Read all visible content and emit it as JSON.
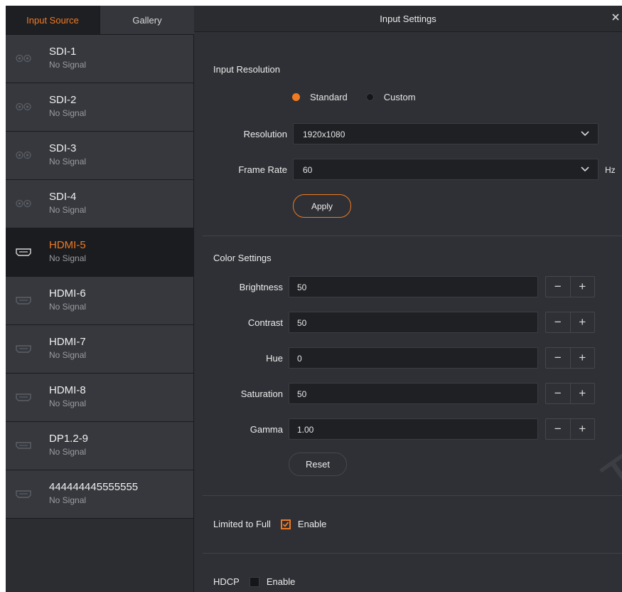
{
  "tabs": [
    {
      "label": "Input Source",
      "active": true
    },
    {
      "label": "Gallery",
      "active": false
    }
  ],
  "sources": [
    {
      "name": "SDI-1",
      "status": "No Signal",
      "icon": "sdi-connector-icon"
    },
    {
      "name": "SDI-2",
      "status": "No Signal",
      "icon": "sdi-connector-icon"
    },
    {
      "name": "SDI-3",
      "status": "No Signal",
      "icon": "sdi-connector-icon"
    },
    {
      "name": "SDI-4",
      "status": "No Signal",
      "icon": "sdi-connector-icon"
    },
    {
      "name": "HDMI-5",
      "status": "No Signal",
      "icon": "hdmi-port-icon",
      "active": true
    },
    {
      "name": "HDMI-6",
      "status": "No Signal",
      "icon": "hdmi-port-icon"
    },
    {
      "name": "HDMI-7",
      "status": "No Signal",
      "icon": "hdmi-port-icon"
    },
    {
      "name": "HDMI-8",
      "status": "No Signal",
      "icon": "hdmi-port-icon"
    },
    {
      "name": "DP1.2-9",
      "status": "No Signal",
      "icon": "displayport-icon"
    },
    {
      "name": "444444445555555",
      "status": "No Signal",
      "icon": "hdmi-port-icon"
    }
  ],
  "panel": {
    "title": "Input Settings",
    "close_icon": "close-icon"
  },
  "input_resolution": {
    "title": "Input Resolution",
    "mode_options": [
      {
        "label": "Standard",
        "selected": true
      },
      {
        "label": "Custom",
        "selected": false
      }
    ],
    "resolution_label": "Resolution",
    "resolution_value": "1920x1080",
    "frame_rate_label": "Frame Rate",
    "frame_rate_value": "60",
    "frame_rate_unit": "Hz",
    "apply_label": "Apply"
  },
  "color_settings": {
    "title": "Color Settings",
    "fields": [
      {
        "label": "Brightness",
        "value": "50"
      },
      {
        "label": "Contrast",
        "value": "50"
      },
      {
        "label": "Hue",
        "value": "0"
      },
      {
        "label": "Saturation",
        "value": "50"
      },
      {
        "label": "Gamma",
        "value": "1.00"
      }
    ],
    "decrement_symbol": "−",
    "increment_symbol": "+",
    "reset_label": "Reset"
  },
  "limited_to_full": {
    "label": "Limited to Full",
    "option_label": "Enable",
    "checked": true
  },
  "hdcp": {
    "label": "HDCP",
    "option_label": "Enable",
    "checked": false
  },
  "watermark": "TECH CO",
  "colors": {
    "accent": "#f07a22",
    "background": "#2e3035",
    "field": "#1f2024",
    "active_row": "#1b1c1f"
  }
}
